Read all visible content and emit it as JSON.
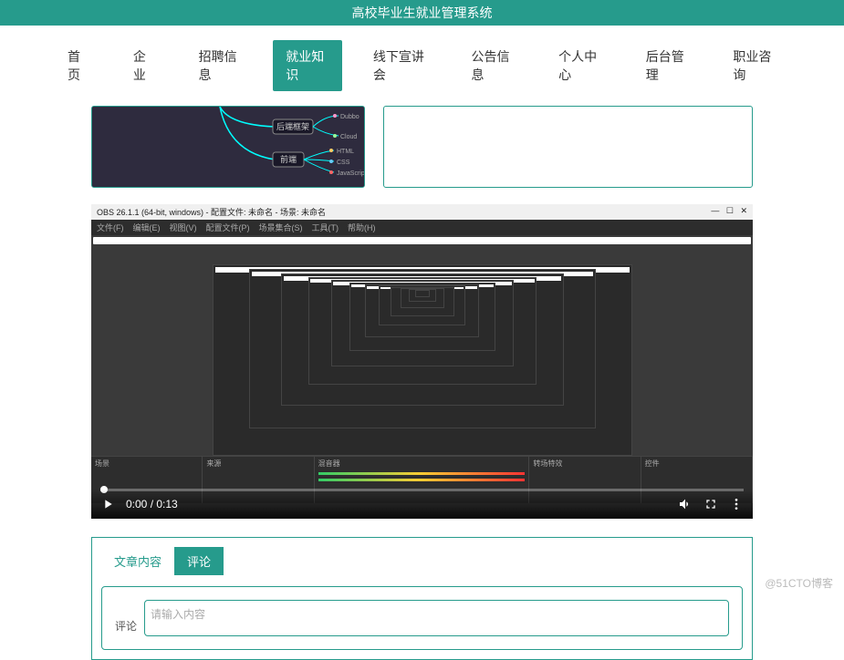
{
  "header": {
    "title": "高校毕业生就业管理系统"
  },
  "nav": {
    "items": [
      {
        "label": "首页"
      },
      {
        "label": "企业"
      },
      {
        "label": "招聘信息"
      },
      {
        "label": "就业知识",
        "active": true
      },
      {
        "label": "线下宣讲会"
      },
      {
        "label": "公告信息"
      },
      {
        "label": "个人中心"
      },
      {
        "label": "后台管理"
      },
      {
        "label": "职业咨询"
      }
    ]
  },
  "mindmap": {
    "nodes": [
      "后端框架",
      "前端"
    ],
    "leaves_top": [
      "Dubbo",
      "Cloud"
    ],
    "leaves_bot": [
      "HTML",
      "CSS",
      "JavaScript"
    ]
  },
  "video": {
    "window_title": "OBS 26.1.1 (64-bit, windows) - 配置文件: 未命名 - 场景: 未命名",
    "menus": [
      "文件(F)",
      "编辑(E)",
      "视图(V)",
      "配置文件(P)",
      "场景集合(S)",
      "工具(T)",
      "帮助(H)"
    ],
    "panels": [
      "场景",
      "来源",
      "混音器",
      "转场特效",
      "控件"
    ],
    "time": "0:00 / 0:13"
  },
  "comments": {
    "tabs": [
      {
        "label": "文章内容"
      },
      {
        "label": "评论",
        "active": true
      }
    ],
    "label": "评论",
    "placeholder": "请输入内容"
  },
  "watermark": "@51CTO博客"
}
